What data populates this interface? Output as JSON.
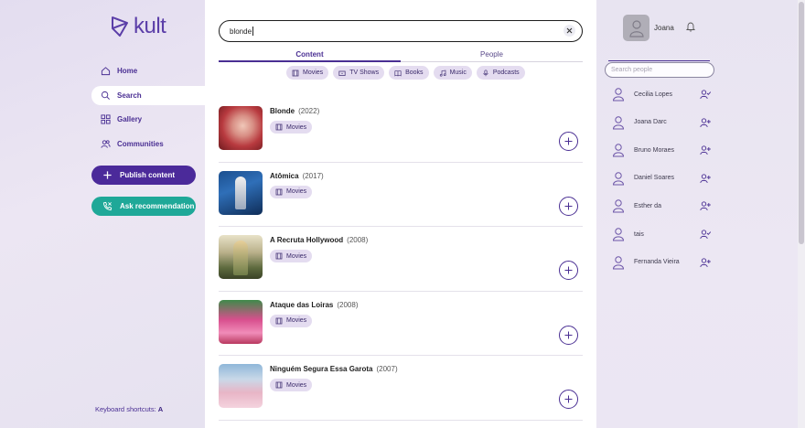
{
  "brand": {
    "name": "kult"
  },
  "sidebar": {
    "items": [
      {
        "label": "Home",
        "icon": "home-icon"
      },
      {
        "label": "Search",
        "icon": "search-icon"
      },
      {
        "label": "Gallery",
        "icon": "gallery-icon"
      },
      {
        "label": "Communities",
        "icon": "communities-icon"
      }
    ],
    "publish_label": "Publish content",
    "ask_label": "Ask recommendation",
    "shortcuts_label": "Keyboard shortcuts:",
    "shortcuts_key": "A"
  },
  "search": {
    "value": "blonde"
  },
  "tabs": [
    {
      "label": "Content"
    },
    {
      "label": "People"
    }
  ],
  "filters": [
    {
      "label": "Movies",
      "icon": "film-icon"
    },
    {
      "label": "TV Shows",
      "icon": "tv-icon"
    },
    {
      "label": "Books",
      "icon": "book-icon"
    },
    {
      "label": "Music",
      "icon": "music-icon"
    },
    {
      "label": "Podcasts",
      "icon": "mic-icon"
    }
  ],
  "results": [
    {
      "title": "Blonde",
      "year": "(2022)",
      "tag": "Movies"
    },
    {
      "title": "Atômica",
      "year": "(2017)",
      "tag": "Movies"
    },
    {
      "title": "A Recruta Hollywood",
      "year": "(2008)",
      "tag": "Movies"
    },
    {
      "title": "Ataque das Loiras",
      "year": "(2008)",
      "tag": "Movies"
    },
    {
      "title": "Ninguém Segura Essa Garota",
      "year": "(2007)",
      "tag": "Movies"
    }
  ],
  "profile": {
    "name": "Joana"
  },
  "people_search": {
    "placeholder": "Search people"
  },
  "people": [
    {
      "name": "Cecilia Lopes",
      "status": "following"
    },
    {
      "name": "Joana Darc",
      "status": "add"
    },
    {
      "name": "Bruno Moraes",
      "status": "add"
    },
    {
      "name": "Daniel Soares",
      "status": "add"
    },
    {
      "name": "Esther da",
      "status": "add"
    },
    {
      "name": "tais",
      "status": "following"
    },
    {
      "name": "Fernanda Vieira",
      "status": "add"
    }
  ],
  "colors": {
    "brand_purple": "#4b2a9a",
    "accent_teal": "#1fa898",
    "chip_bg": "#e4dcf0"
  }
}
